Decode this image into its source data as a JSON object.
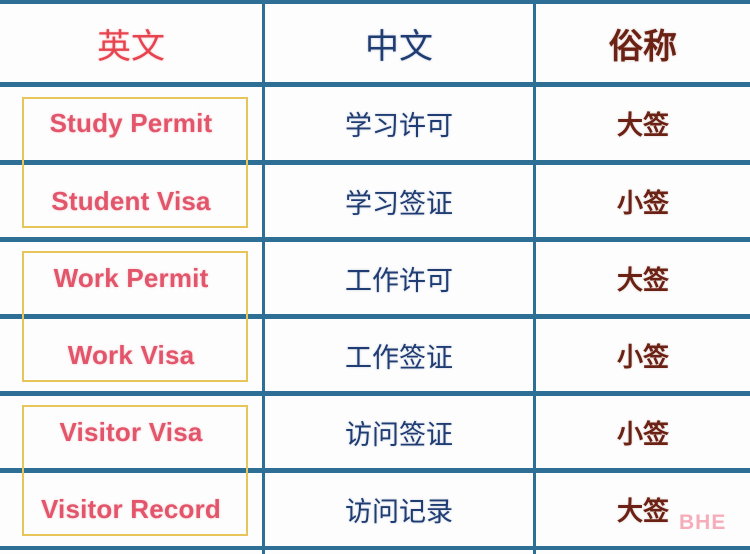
{
  "table": {
    "headers": [
      {
        "label": "英文",
        "name": "header-english"
      },
      {
        "label": "中文",
        "name": "header-chinese"
      },
      {
        "label": "俗称",
        "name": "header-nickname"
      }
    ],
    "rows": [
      {
        "english": "Study Permit",
        "chinese": "学习许可",
        "nickname": "大签"
      },
      {
        "english": "Student Visa",
        "chinese": "学习签证",
        "nickname": "小签"
      },
      {
        "english": "Work Permit",
        "chinese": "工作许可",
        "nickname": "大签"
      },
      {
        "english": "Work Visa",
        "chinese": "工作签证",
        "nickname": "小签"
      },
      {
        "english": "Visitor Visa",
        "chinese": "访问签证",
        "nickname": "小签"
      },
      {
        "english": "Visitor Record",
        "chinese": "访问记录",
        "nickname": "大签"
      }
    ]
  },
  "watermark": {
    "text": "BHE"
  },
  "colors": {
    "rule": "#2e6f95",
    "english_text": "#e2556a",
    "chinese_text": "#1f3c73",
    "nickname_text": "#6b2113",
    "highlight_box": "#e8c55a",
    "watermark": "#f6adba"
  }
}
